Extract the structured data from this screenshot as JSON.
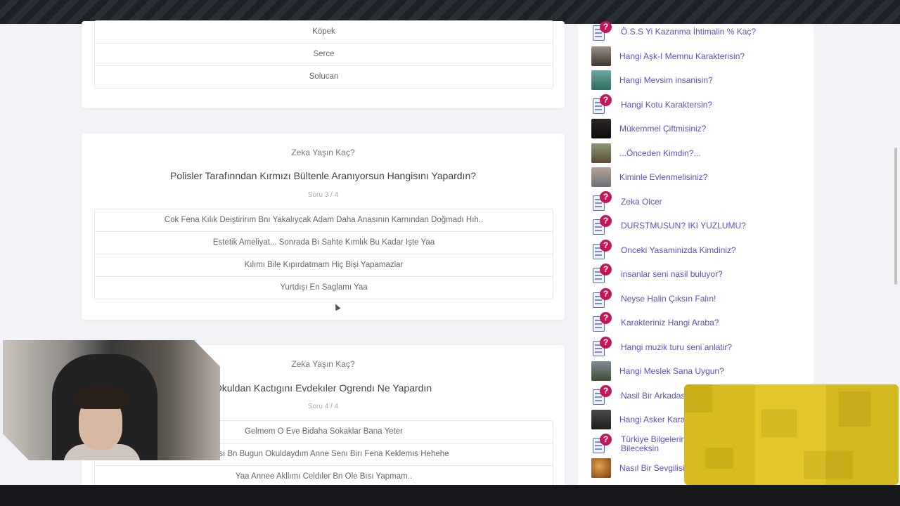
{
  "card1": {
    "options": [
      "Köpek",
      "Serce",
      "Solucan"
    ]
  },
  "card2": {
    "category": "Zeka Yaşın Kaç?",
    "question": "Polisler Tarafınndan Kırmızı Bültenle Aranıyorsun Hangisını Yapardın?",
    "counter": "Soru 3 / 4",
    "options": [
      "Cok Fena Kılık Deiştirirım Bnı Yakalıycak Adam Daha Anasının Karnından Doğmadı Hıh..",
      "Estetik Ameliyat... Sonrada Bı Sahte Kımlık Bu Kadar Işte Yaa",
      "Kılımı Bile Kıpırdatmam Hiç Bişi Yapamazlar",
      "Yurtdışı En Saglamı Yaa"
    ]
  },
  "card3": {
    "category": "Zeka Yaşın Kaç?",
    "question": "Okuldan Kactıgını Evdekıler Ogrendı Ne Yapardın",
    "counter": "Soru 4 / 4",
    "options": [
      "Gelmem O Eve Bidaha Sokaklar Bana Yeter",
      "naması Bn Bugun Okuldaydım Anne Senı Birı Fena Keklemıs Hehehe",
      "Yaa Annee Akllımı Celdıler Bn Ole Bısı Yapmam.."
    ]
  },
  "sidebar": {
    "items": [
      {
        "label": "Ö.S.S Yi Kazanma İhtimalin % Kaç?",
        "icon": "quiz-icon"
      },
      {
        "label": "Hangi Aşk-I Memnu Karakterisin?",
        "icon": "thumbnail"
      },
      {
        "label": "Hangi Mevsim insanisin?",
        "icon": "thumbnail"
      },
      {
        "label": "Hangi Kotu Karaktersin?",
        "icon": "quiz-icon"
      },
      {
        "label": "Mükemmel Çiftmisiniz?",
        "icon": "thumbnail"
      },
      {
        "label": "...Önceden Kimdin?...",
        "icon": "thumbnail"
      },
      {
        "label": "Kiminle Evlenmelisiniz?",
        "icon": "thumbnail"
      },
      {
        "label": "Zeka Olcer",
        "icon": "quiz-icon"
      },
      {
        "label": "DURSTMUSUN? IKI YUZLUMU?",
        "icon": "quiz-icon"
      },
      {
        "label": "Onceki Yasaminizda Kimdiniz?",
        "icon": "quiz-icon"
      },
      {
        "label": "insanlar seni nasil buluyor?",
        "icon": "quiz-icon"
      },
      {
        "label": "Neyse Halin Çıksın Falın!",
        "icon": "quiz-icon"
      },
      {
        "label": "Karakteriniz Hangi Araba?",
        "icon": "quiz-icon"
      },
      {
        "label": "Hangi muzik turu seni anlatir?",
        "icon": "quiz-icon"
      },
      {
        "label": "Hangi Meslek Sana Uygun?",
        "icon": "thumbnail"
      },
      {
        "label": "Nasil Bir Arkadas",
        "icon": "quiz-icon"
      },
      {
        "label": "Hangi Asker Kara",
        "icon": "thumbnail"
      },
      {
        "label": "Türkiye Bilgelerin",
        "label2": "Bileceksin",
        "icon": "quiz-icon"
      },
      {
        "label": "Nasıl Bir Sevgilisi",
        "icon": "thumbnail"
      }
    ]
  },
  "colors": {
    "accent_link": "#5c4fc1",
    "quiz_badge": "#c2185b",
    "overlay_yellow": "#e0c321"
  }
}
